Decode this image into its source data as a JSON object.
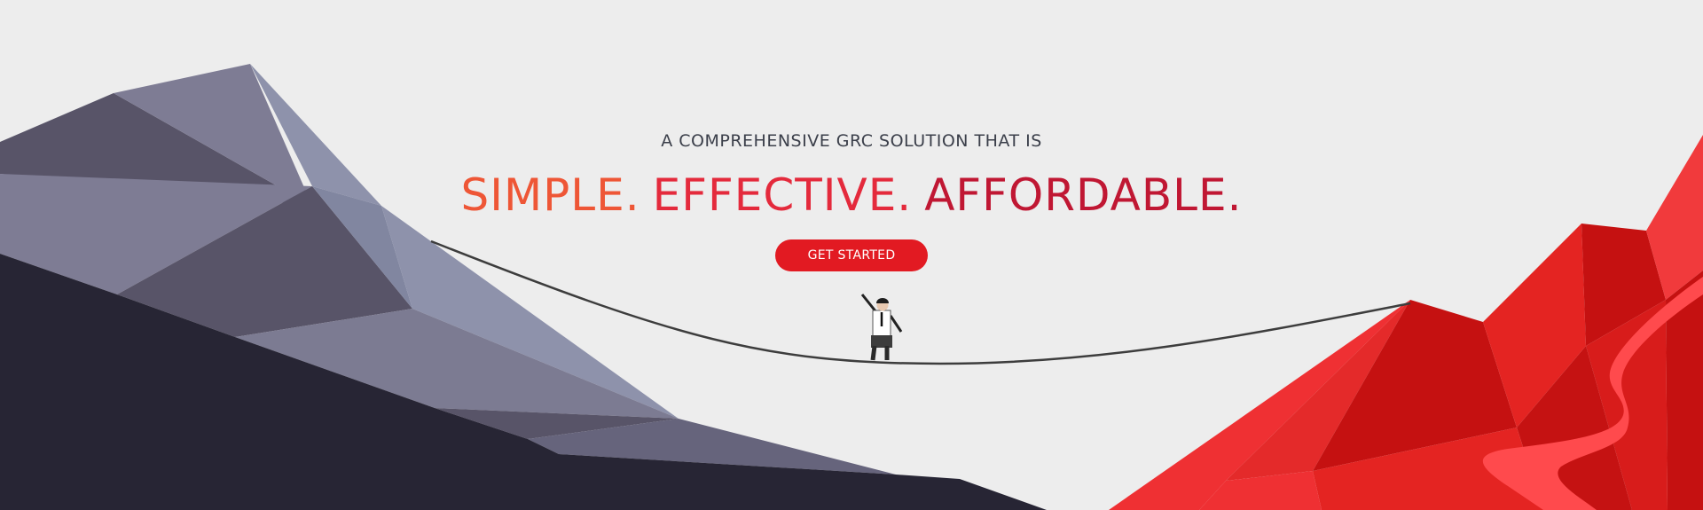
{
  "hero": {
    "eyebrow": "A COMPREHENSIVE GRC SOLUTION THAT IS",
    "headline": {
      "word1": "SIMPLE.",
      "word2": "EFFECTIVE.",
      "word3": "AFFORDABLE."
    },
    "cta_label": "GET STARTED"
  },
  "colors": {
    "background": "#ededed",
    "word1": "#ee5636",
    "word2": "#e42a3c",
    "word3": "#c01733",
    "cta": "#e21a22",
    "mountain_dark": "#272534",
    "mountain_red": "#e0231f"
  },
  "illustration": {
    "left": "grey-mountain-illustration",
    "right": "red-mountain-illustration",
    "figure": "tightrope-walker-illustration",
    "rope": "tightrope-line"
  }
}
